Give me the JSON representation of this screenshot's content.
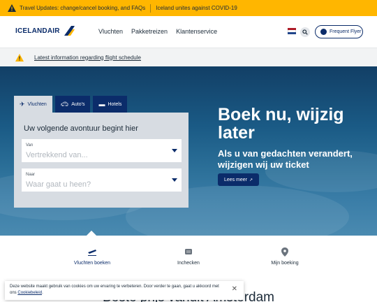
{
  "topbar": {
    "travel_updates": "Travel Updates: change/cancel booking, and FAQs",
    "covid": "Iceland unites against COVID-19"
  },
  "header": {
    "logo_text": "ICELANDAIR",
    "nav": [
      "Vluchten",
      "Pakketreizen",
      "Klantenservice"
    ],
    "frequent_flyer": "Frequent Flyer",
    "language_flag": "NL"
  },
  "alert": {
    "text": "Latest information regarding flight schedule"
  },
  "booking": {
    "tabs": [
      "Vluchten",
      "Auto's",
      "Hotels"
    ],
    "title": "Uw volgende avontuur begint hier",
    "from_label": "Van",
    "from_placeholder": "Vertrekkend van...",
    "to_label": "Naar",
    "to_placeholder": "Waar gaat u heen?"
  },
  "hero": {
    "heading": "Boek nu, wijzig later",
    "subheading": "Als u van gedachten verandert, wijzigen wij uw ticket",
    "more_button": "Lees meer"
  },
  "quick_links": [
    "Vluchten boeken",
    "Inchecken",
    "Mijn boeking"
  ],
  "section_title": "Beste prijs vanuit Amsterdam",
  "cookie": {
    "text": "Deze website maakt gebruik van cookies om uw ervaring te verbeteren. Door verder te gaan, gaat u akkoord met ons",
    "link": "Cookiebeleid",
    "end": "."
  },
  "colors": {
    "brand_navy": "#0b2c6a",
    "alert_yellow": "#ffb600"
  }
}
